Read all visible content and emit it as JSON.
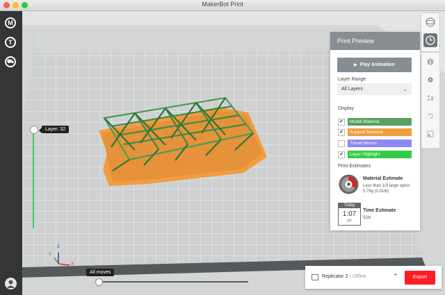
{
  "app": {
    "title": "MakerBot Print"
  },
  "sidebar": {
    "items": [
      {
        "icon": "makerbot-logo-icon",
        "glyph": "M"
      },
      {
        "icon": "thingiverse-icon",
        "glyph": "T"
      },
      {
        "icon": "cart-icon",
        "glyph": "⛟"
      }
    ]
  },
  "viewport": {
    "layer_tooltip": "Layer: 32",
    "moves_tooltip": "All moves",
    "axis": {
      "x": "X",
      "y": "Y",
      "z": "Z"
    }
  },
  "panel": {
    "title": "Print Preview",
    "play_label": "Play Animation",
    "layer_range_label": "Layer Range",
    "layer_range_value": "All Layers",
    "display_label": "Display",
    "display_items": [
      {
        "label": "Model Material",
        "checked": "✔",
        "color": "#5aa05f"
      },
      {
        "label": "Support Material",
        "checked": "✔",
        "color": "#f29c3e"
      },
      {
        "label": "Travel Moves",
        "checked": "",
        "color": "#8e87f2"
      },
      {
        "label": "Layer Highlight",
        "checked": "✔",
        "color": "#33cc44"
      }
    ],
    "estimates_label": "Print Estimates",
    "material": {
      "title": "Material Estimate",
      "line1": "Less than 1/3 large spool",
      "line2": "5.79g (0.01lb)"
    },
    "time": {
      "title": "Time Estimate",
      "value": "52m",
      "cal_head": "Today",
      "cal_time": "1:07",
      "cal_pm": "pm"
    }
  },
  "bottom": {
    "printer": "Replicator 2",
    "status": "• Offline",
    "export_label": "Export"
  },
  "colors": {
    "accent": "#ff1d25",
    "sidebar": "#333537",
    "model": "#5aa05f",
    "support": "#f29c3e",
    "layer_slider": "#45c85a"
  }
}
